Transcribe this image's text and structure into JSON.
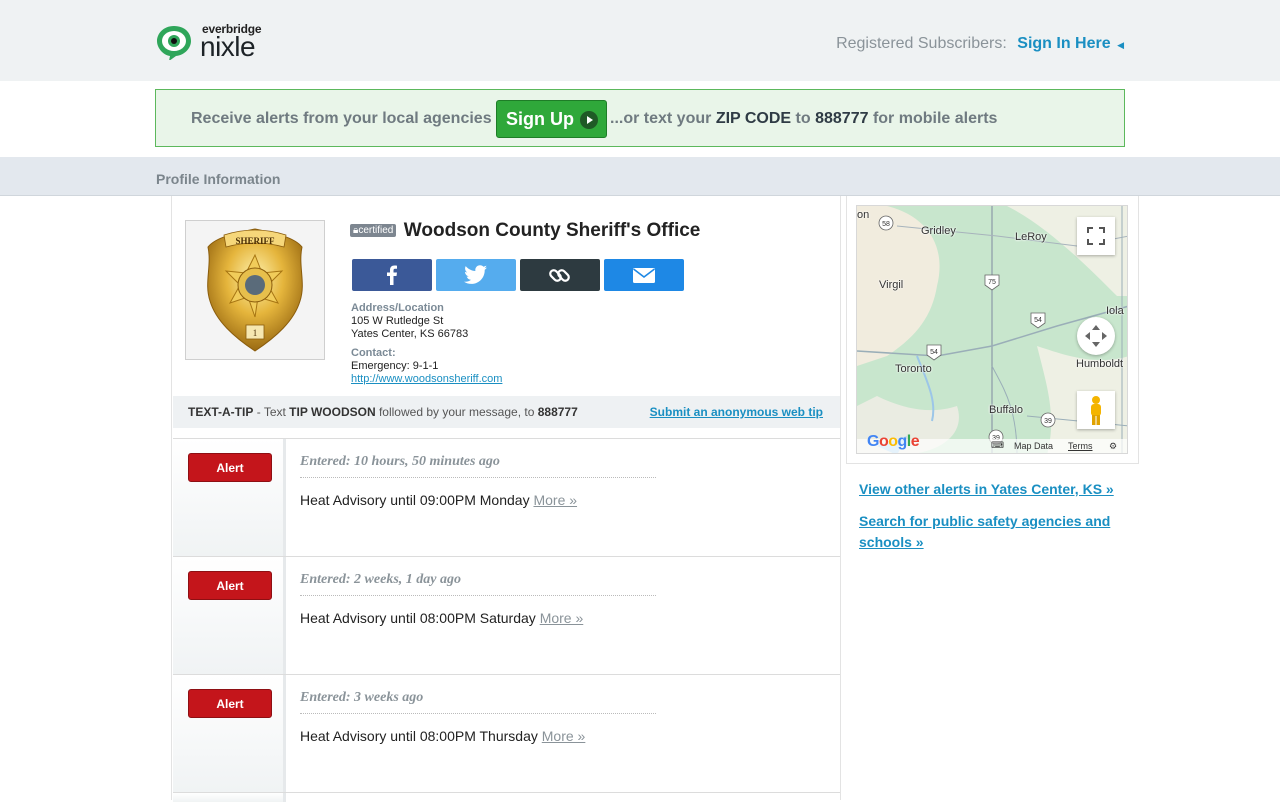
{
  "header": {
    "brand": "everbridge",
    "logo_name": "nixle",
    "registered_label": "Registered Subscribers:",
    "signin_label": "Sign In Here"
  },
  "banner": {
    "lead_text": "Receive alerts from your local agencies",
    "signup_label": "Sign Up",
    "tail_pre": "...or text your",
    "tail_zip": "ZIP CODE",
    "tail_to": "to",
    "tail_number": "888777",
    "tail_post": "for mobile alerts"
  },
  "section": {
    "title": "Profile Information"
  },
  "profile": {
    "certified_label": "certified",
    "title": "Woodson County Sheriff's Office",
    "badge_text_top": "SHERIFF",
    "badge_text_num": "1",
    "share_buttons": [
      "facebook-icon",
      "twitter-icon",
      "link-icon",
      "email-icon"
    ],
    "address_label": "Address/Location",
    "address_line1": "105 W Rutledge St",
    "address_line2": "Yates Center, KS 66783",
    "contact_label": "Contact:",
    "emergency": "Emergency: 9-1-1",
    "website": "http://www.woodsonsheriff.com"
  },
  "tip": {
    "label": "TEXT-A-TIP",
    "dash": "-",
    "text_pre": "Text",
    "keyword": "TIP WOODSON",
    "text_mid": "followed by your message, to",
    "number": "888777",
    "web_tip_link": "Submit an anonymous web tip"
  },
  "alerts": [
    {
      "badge": "Alert",
      "entered": "Entered: 10 hours, 50 minutes ago",
      "message": "Heat Advisory until 09:00PM Monday",
      "more": "More »"
    },
    {
      "badge": "Alert",
      "entered": "Entered: 2 weeks, 1 day ago",
      "message": "Heat Advisory until 08:00PM Saturday",
      "more": "More »"
    },
    {
      "badge": "Alert",
      "entered": "Entered: 3 weeks ago",
      "message": "Heat Advisory until 08:00PM Thursday",
      "more": "More »"
    }
  ],
  "map": {
    "towns": [
      "on",
      "Gridley",
      "LeRoy",
      "Virgil",
      "Iola",
      "Toronto",
      "Humboldt",
      "Buffalo"
    ],
    "route_shields": [
      "58",
      "75",
      "54",
      "54",
      "39",
      "39"
    ],
    "google_logo": "Google",
    "footer": {
      "map_data": "Map Data",
      "terms": "Terms"
    }
  },
  "sidebar": {
    "other_alerts_link": "View other alerts in Yates Center, KS »",
    "search_link": "Search for public safety agencies and schools »"
  },
  "colors": {
    "link_blue": "#1a8fc2",
    "signup_green": "#2fa83a",
    "alert_red": "#c4151b",
    "facebook": "#3b5998",
    "twitter": "#55acee",
    "link_dark": "#2d3a40",
    "email_blue": "#1e88e5"
  }
}
